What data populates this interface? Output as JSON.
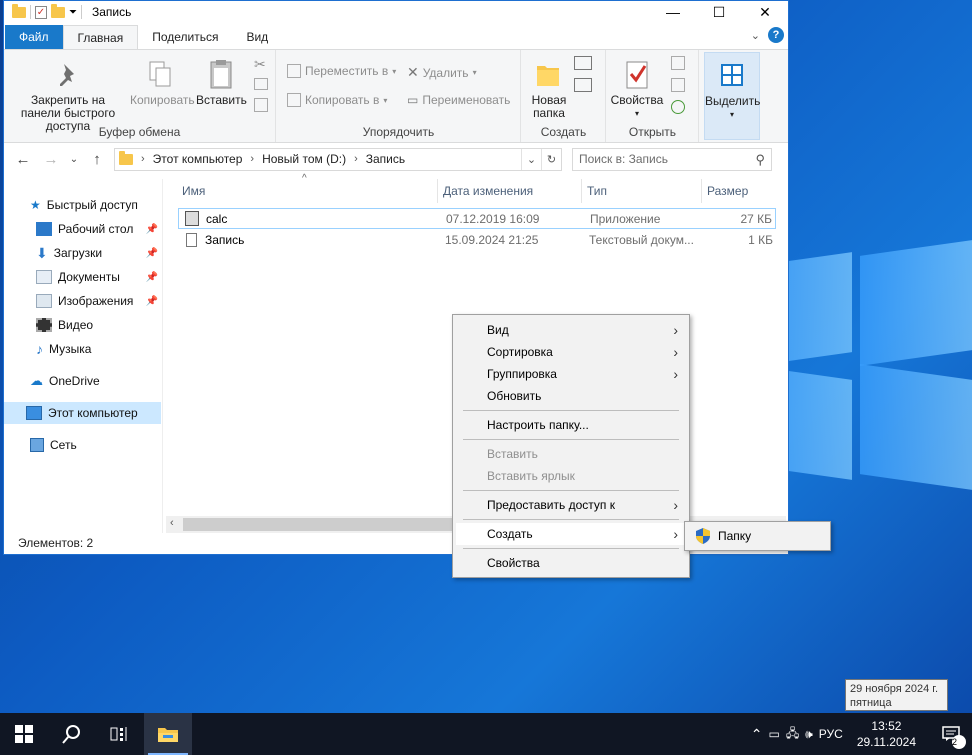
{
  "window": {
    "title": "Запись",
    "minimize": "—",
    "maximize": "☐",
    "close": "✕"
  },
  "ribbon_tabs": [
    "Файл",
    "Главная",
    "Поделиться",
    "Вид"
  ],
  "ribbon": {
    "clipboard": {
      "label": "Буфер обмена",
      "pin": "Закрепить на панели быстрого доступа",
      "copy": "Копировать",
      "paste": "Вставить"
    },
    "organize": {
      "label": "Упорядочить",
      "move": "Переместить в",
      "copy_to": "Копировать в",
      "delete": "Удалить",
      "rename": "Переименовать"
    },
    "new": {
      "label": "Создать",
      "new_folder": "Новая папка"
    },
    "open": {
      "label": "Открыть",
      "properties": "Свойства"
    },
    "select": {
      "label": "Выделить"
    }
  },
  "address": {
    "crumbs": [
      "Этот компьютер",
      "Новый том (D:)",
      "Запись"
    ],
    "search_placeholder": "Поиск в: Запись"
  },
  "navpane": {
    "quick_access": "Быстрый доступ",
    "desktop": "Рабочий стол",
    "downloads": "Загрузки",
    "documents": "Документы",
    "pictures": "Изображения",
    "video": "Видео",
    "music": "Музыка",
    "onedrive": "OneDrive",
    "this_pc": "Этот компьютер",
    "network": "Сеть"
  },
  "columns": {
    "name": "Имя",
    "date": "Дата изменения",
    "type": "Тип",
    "size": "Размер"
  },
  "files": [
    {
      "name": "calc",
      "date": "07.12.2019 16:09",
      "type": "Приложение",
      "size": "27 КБ"
    },
    {
      "name": "Запись",
      "date": "15.09.2024 21:25",
      "type": "Текстовый докум...",
      "size": "1 КБ"
    }
  ],
  "status": {
    "items": "Элементов: 2"
  },
  "context_menu": {
    "view": "Вид",
    "sort": "Сортировка",
    "group": "Группировка",
    "refresh": "Обновить",
    "customize": "Настроить папку...",
    "paste": "Вставить",
    "paste_shortcut": "Вставить ярлык",
    "share": "Предоставить доступ к",
    "create": "Создать",
    "properties": "Свойства"
  },
  "submenu": {
    "folder": "Папку"
  },
  "tooltip": {
    "line1": "29 ноября 2024 г.",
    "line2": "пятница"
  },
  "taskbar": {
    "lang": "РУС",
    "time": "13:52",
    "date": "29.11.2024",
    "notifications": "2"
  },
  "colors": {
    "accent": "#1979ca",
    "selection": "#cce8ff",
    "taskbar": "#101623"
  }
}
